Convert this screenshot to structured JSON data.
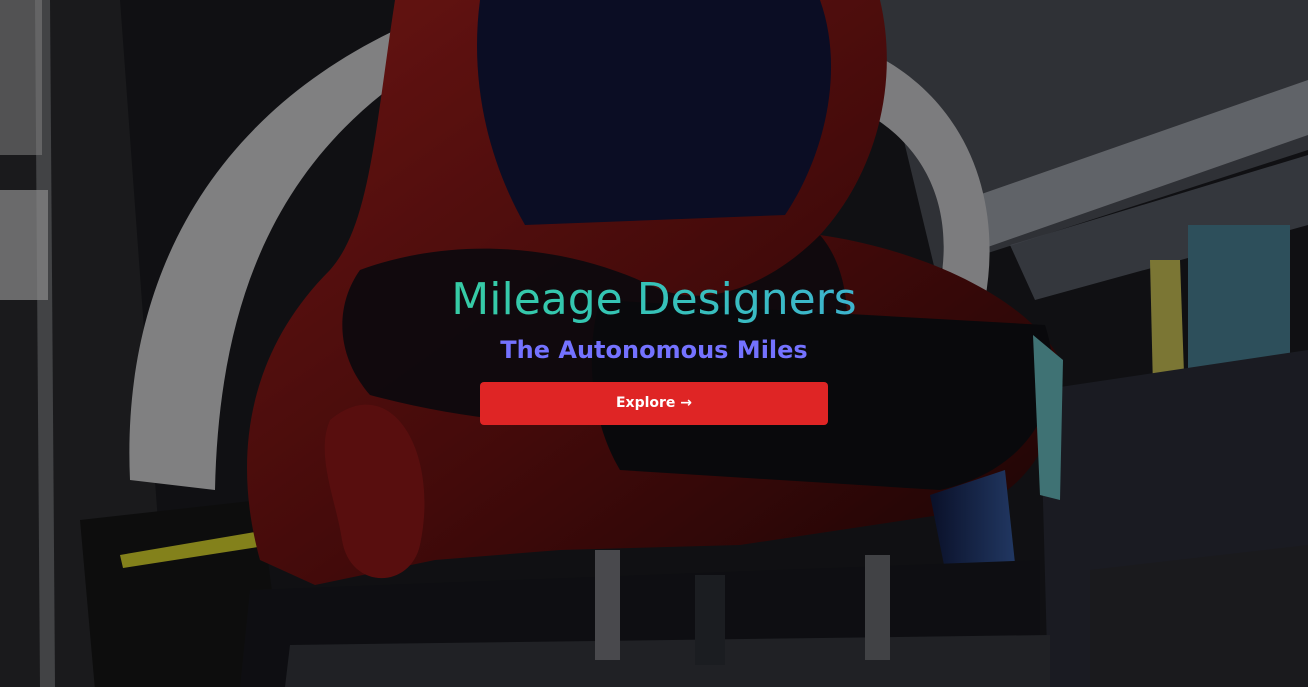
{
  "hero": {
    "title": "Mileage Designers",
    "subtitle": "The Autonomous Miles",
    "button_label": "Explore →"
  },
  "colors": {
    "title_gradient_start": "#3fdc7a",
    "title_gradient_mid": "#34c6b1",
    "title_gradient_end": "#4c95ff",
    "subtitle": "#7472ff",
    "button_background": "#df2525",
    "button_text": "#ffffff"
  }
}
